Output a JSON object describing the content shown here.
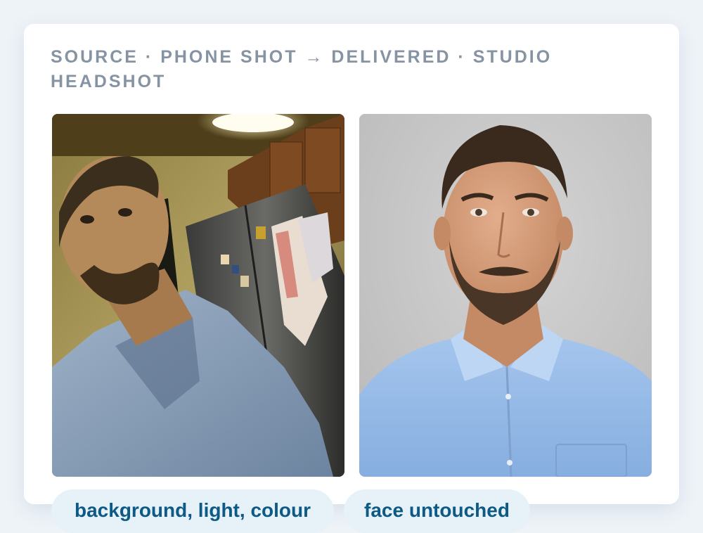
{
  "caption": {
    "source_label": "Source",
    "source_value": "Phone shot",
    "arrow": "→",
    "delivered_label": "Delivered",
    "delivered_value": "Studio headshot"
  },
  "images": {
    "before": {
      "alt": "Phone selfie of a bearded man in a light blue shirt in a kitchen"
    },
    "after": {
      "alt": "Studio headshot of the same bearded man in a light blue shirt on a grey background"
    }
  },
  "tags": [
    {
      "label": "background, light, colour"
    },
    {
      "label": "face untouched"
    }
  ],
  "colors": {
    "page_background": "#eef3f8",
    "caption_text": "#8593a3",
    "tag_background": "#e6f1f8",
    "tag_text": "#0e5a86"
  }
}
